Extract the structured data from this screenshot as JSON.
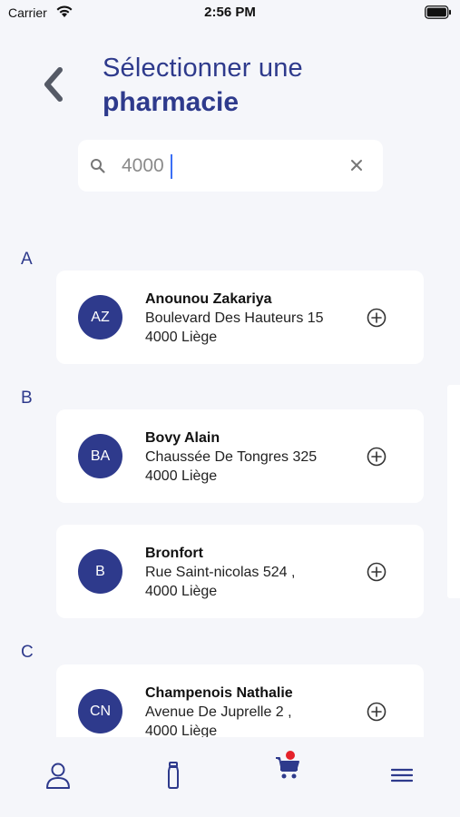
{
  "status_bar": {
    "carrier": "Carrier",
    "time": "2:56 PM"
  },
  "header": {
    "title_line1": "Sélectionner une",
    "title_line2": "pharmacie"
  },
  "search": {
    "value": "4000"
  },
  "sections": [
    {
      "letter": "A",
      "pharmacies": [
        {
          "initials": "AZ",
          "name": "Anounou Zakariya",
          "address": "Boulevard Des Hauteurs 15",
          "city": "4000 Liège"
        }
      ]
    },
    {
      "letter": "B",
      "pharmacies": [
        {
          "initials": "BA",
          "name": "Bovy Alain",
          "address": "Chaussée De Tongres 325",
          "city": "4000 Liège"
        },
        {
          "initials": "B",
          "name": "Bronfort",
          "address": "Rue Saint-nicolas 524 ,",
          "city": "4000 Liège"
        }
      ]
    },
    {
      "letter": "C",
      "pharmacies": [
        {
          "initials": "CN",
          "name": "Champenois Nathalie",
          "address": "Avenue De Juprelle 2 ,",
          "city": "4000 Liège"
        }
      ]
    }
  ],
  "tab_bar": {
    "tabs": [
      {
        "icon": "user-icon"
      },
      {
        "icon": "medicine-bottle-icon"
      },
      {
        "icon": "cart-icon",
        "badge": true
      },
      {
        "icon": "menu-icon"
      }
    ]
  },
  "colors": {
    "primary": "#2e3a8c",
    "background": "#f5f6fa",
    "badge": "#e5222a",
    "caret": "#3b6ff5"
  }
}
